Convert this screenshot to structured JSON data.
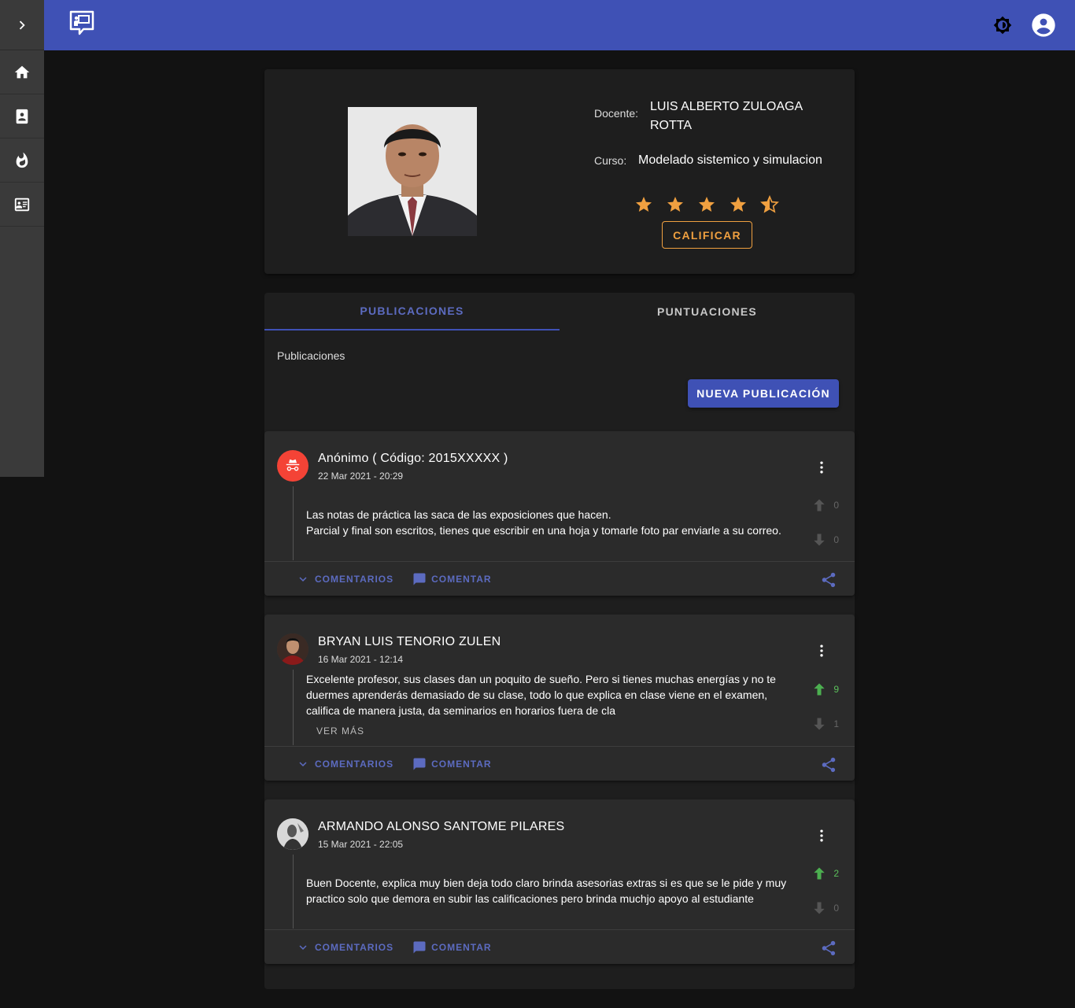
{
  "sidebar": {
    "toggle_icon": "chevron-right-icon",
    "items": [
      {
        "icon": "home-icon"
      },
      {
        "icon": "contacts-book-icon"
      },
      {
        "icon": "fire-icon"
      },
      {
        "icon": "id-card-icon"
      }
    ]
  },
  "topbar": {
    "logo_icon": "teacher-board-icon",
    "theme_icon": "brightness-icon",
    "account_icon": "account-circle-icon",
    "color": "#3f51b5"
  },
  "profile": {
    "docente_label": "Docente:",
    "docente_value": "LUIS ALBERTO ZULOAGA ROTTA",
    "curso_label": "Curso:",
    "curso_value": "Modelado sistemico y simulacion",
    "rating": 4.5,
    "rating_max": 5,
    "rate_button": "CALIFICAR",
    "star_color": "#f0a040"
  },
  "tabs": [
    {
      "label": "PUBLICACIONES",
      "active": true
    },
    {
      "label": "PUNTUACIONES",
      "active": false
    }
  ],
  "section_title": "Publicaciones",
  "new_post_button": "NUEVA PUBLICACIÓN",
  "posts": [
    {
      "author": "Anónimo ( Código: 2015XXXXX )",
      "date": "22 Mar 2021 - 20:29",
      "text_lines": [
        "Las notas de práctica las saca de las exposiciones que hacen.",
        "Parcial y final son escritos, tienes que escribir en una hoja y tomarle foto par enviarle a su correo."
      ],
      "upvotes": "0",
      "downvotes": "0",
      "avatar_icon": "incognito-icon"
    },
    {
      "author": "BRYAN LUIS TENORIO ZULEN",
      "date": "16 Mar 2021 - 12:14",
      "text": "Excelente profesor, sus clases dan un poquito de sueño. Pero si tienes muchas energías y no te duermes aprenderás demasiado de su clase, todo lo que explica en clase viene en el examen, califica de manera justa, da seminarios en horarios fuera de cla",
      "ver_mas": "VER MÁS",
      "upvotes": "9",
      "downvotes": "1"
    },
    {
      "author": "ARMANDO ALONSO SANTOME PILARES",
      "date": "15 Mar 2021 - 22:05",
      "text": "Buen Docente, explica muy bien deja todo claro brinda asesorias extras si es que se le pide y muy practico solo que demora en subir las calificaciones pero brinda muchjo apoyo al estudiante",
      "upvotes": "2",
      "downvotes": "0"
    }
  ],
  "post_actions": {
    "comments": "COMENTARIOS",
    "comment": "COMENTAR"
  }
}
